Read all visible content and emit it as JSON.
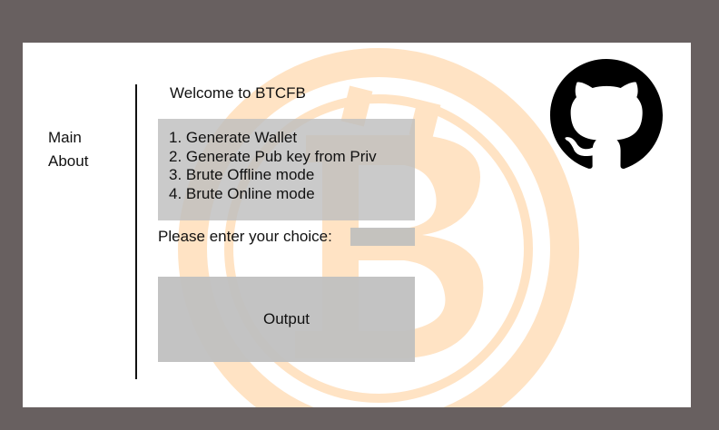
{
  "nav": {
    "main": "Main",
    "about": "About"
  },
  "welcome": "Welcome to BTCFB",
  "menu": [
    "1. Generate Wallet",
    "2. Generate Pub key from Priv",
    "3. Brute Offline mode",
    "4. Brute Online mode"
  ],
  "choice": {
    "label": "Please enter your choice:",
    "value": ""
  },
  "output": {
    "label": "Output"
  },
  "icons": {
    "watermark": "bitcoin-logo-icon",
    "github": "github-icon"
  },
  "colors": {
    "frame": "#686060",
    "panel": "#ffffff",
    "watermark": "#FFE3C4",
    "box": "#BEBEBE",
    "github": "#000000"
  }
}
